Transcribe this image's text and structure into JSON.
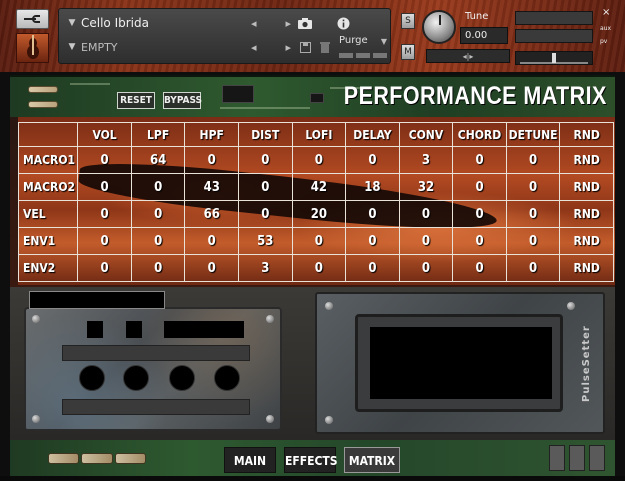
{
  "header": {
    "instrument_name": "Cello Ibrida",
    "preset_name": "EMPTY",
    "purge_label": "Purge",
    "tune_label": "Tune",
    "tune_value": "0.00",
    "solo_label": "S",
    "mute_label": "M",
    "close_label": "×",
    "aux_label": "aux",
    "pv_label": "pv",
    "pan_label": "◂|▸"
  },
  "banner": {
    "reset_label": "RESET",
    "bypass_label": "BYPASS",
    "title": "PERFORMANCE MATRIX"
  },
  "matrix": {
    "columns": [
      "VOL",
      "LPF",
      "HPF",
      "DIST",
      "LOFI",
      "DELAY",
      "CONV",
      "CHORD",
      "DETUNE",
      "RND"
    ],
    "rows": [
      {
        "label": "MACRO1",
        "values": [
          "0",
          "64",
          "0",
          "0",
          "0",
          "0",
          "3",
          "0",
          "0",
          "RND"
        ]
      },
      {
        "label": "MACRO2",
        "values": [
          "0",
          "0",
          "43",
          "0",
          "42",
          "18",
          "32",
          "0",
          "0",
          "RND"
        ]
      },
      {
        "label": "VEL",
        "values": [
          "0",
          "0",
          "66",
          "0",
          "20",
          "0",
          "0",
          "0",
          "0",
          "RND"
        ]
      },
      {
        "label": "ENV1",
        "values": [
          "0",
          "0",
          "0",
          "53",
          "0",
          "0",
          "0",
          "0",
          "0",
          "RND"
        ]
      },
      {
        "label": "ENV2",
        "values": [
          "0",
          "0",
          "0",
          "3",
          "0",
          "0",
          "0",
          "0",
          "0",
          "RND"
        ]
      }
    ]
  },
  "lower": {
    "brand": "PulseSetter"
  },
  "footer": {
    "tabs": [
      {
        "label": "MAIN"
      },
      {
        "label": "EFFECTS"
      },
      {
        "label": "MATRIX"
      }
    ],
    "active_tab": "MATRIX"
  }
}
